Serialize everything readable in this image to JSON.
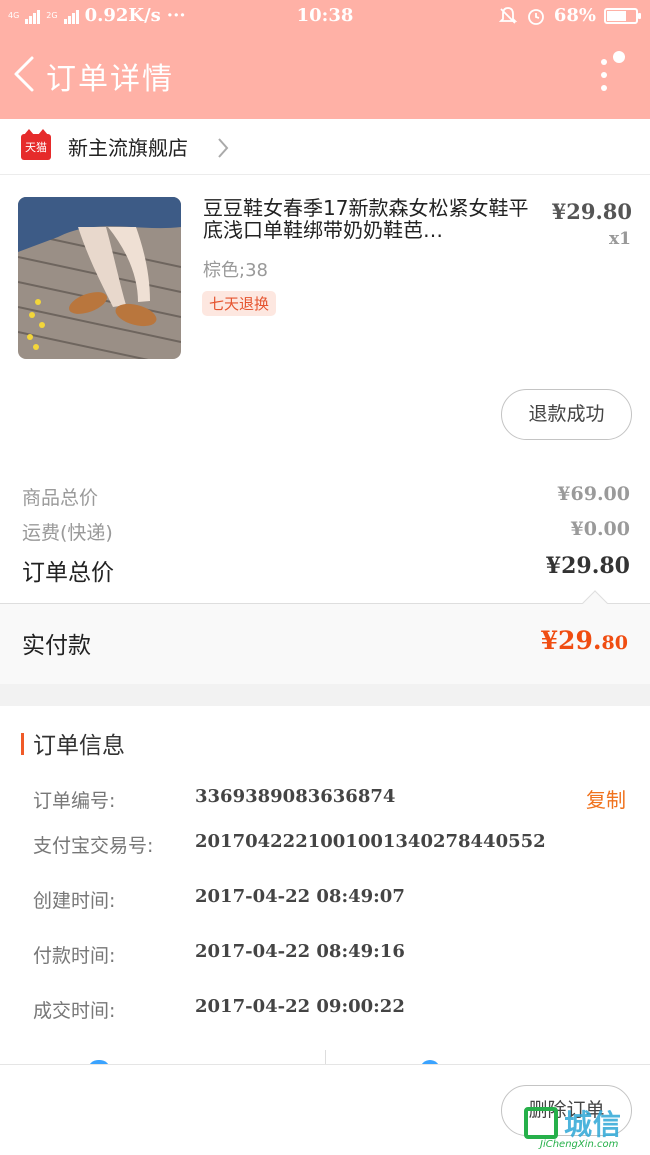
{
  "status_bar": {
    "net_left": "4G",
    "net_left_small": "4G",
    "net_right_small": "2G",
    "speed": "0.92K/s",
    "more": "···",
    "time": "10:38",
    "battery": "68%",
    "battery_level": 0.68
  },
  "header": {
    "title": "订单详情"
  },
  "shop": {
    "badge": "天猫",
    "name": "新主流旗舰店"
  },
  "product": {
    "title": "豆豆鞋女春季17新款森女松紧女鞋平底浅口单鞋绑带奶奶鞋芭…",
    "price": "¥29.80",
    "qty": "x1",
    "sku": "棕色;38",
    "tag": "七天退换",
    "status_button": "退款成功"
  },
  "costs": {
    "goods_total_label": "商品总价",
    "goods_total_value": "¥69.00",
    "shipping_label": "运费(快递)",
    "shipping_value": "¥0.00",
    "order_total_label": "订单总价",
    "order_total_value": "¥29.80"
  },
  "payment": {
    "label": "实付款",
    "value_main": "¥29.",
    "value_cents": "80"
  },
  "order_info": {
    "section_title": "订单信息",
    "copy_label": "复制",
    "rows": [
      {
        "label": "订单编号:",
        "value": "3369389083636874"
      },
      {
        "label": "支付宝交易号:",
        "value": "2017042221001001340278440552"
      },
      {
        "label": "创建时间:",
        "value": "2017-04-22 08:49:07"
      },
      {
        "label": "付款时间:",
        "value": "2017-04-22 08:49:16"
      },
      {
        "label": "成交时间:",
        "value": "2017-04-22 09:00:22"
      }
    ]
  },
  "bottom": {
    "delete_button": "删除订单"
  },
  "watermark": {
    "cn": "城信",
    "en": "JiChengXin.com"
  },
  "colors": {
    "header_bg": "#ffb1a6",
    "accent": "#f04d12",
    "copy": "#f0721d",
    "tmall_red": "#e62b2b"
  }
}
